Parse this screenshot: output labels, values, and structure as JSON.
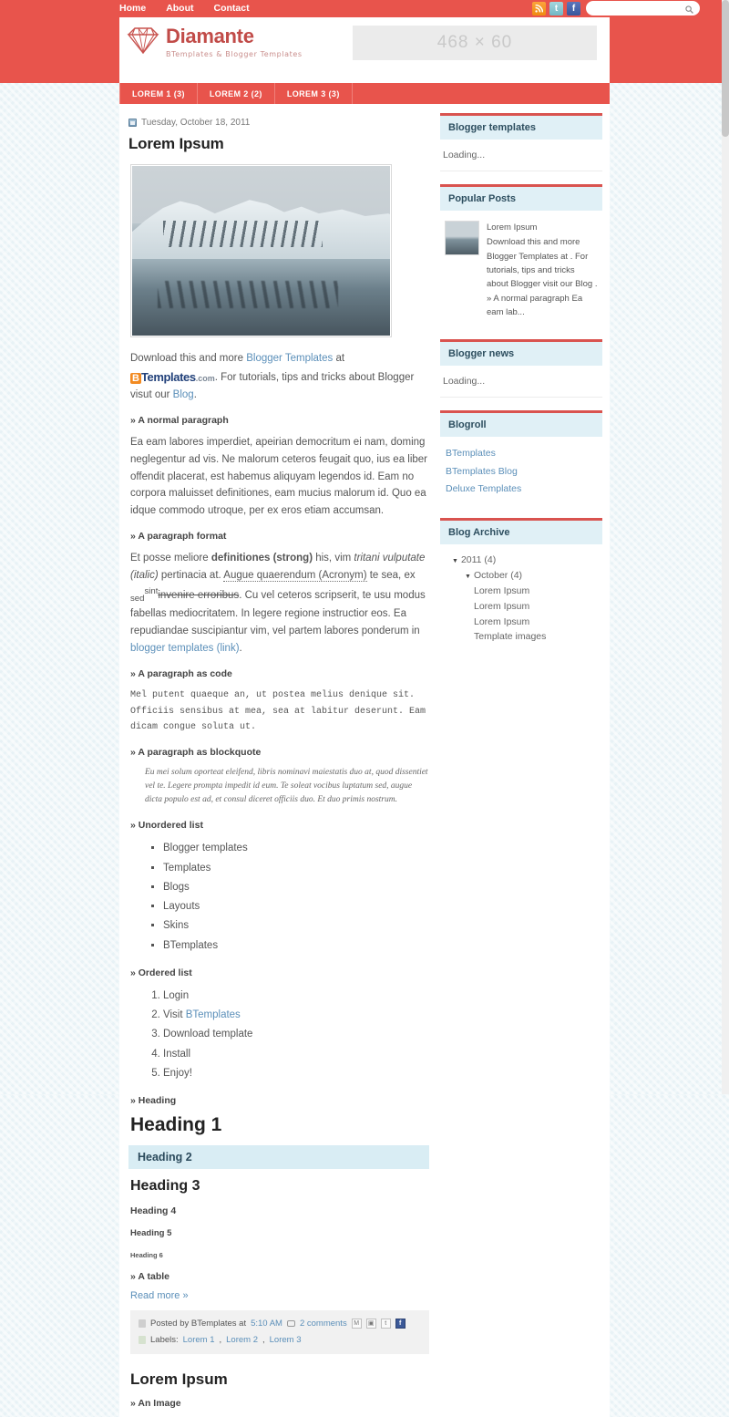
{
  "topbar": {
    "nav": [
      {
        "label": "Home"
      },
      {
        "label": "About"
      },
      {
        "label": "Contact"
      }
    ],
    "social": [
      {
        "name": "rss",
        "glyph": "◕"
      },
      {
        "name": "twitter",
        "glyph": "t"
      },
      {
        "name": "facebook",
        "glyph": "f"
      }
    ],
    "search": {
      "value": "",
      "placeholder": ""
    }
  },
  "header": {
    "brand": "Diamante",
    "tagline": "BTemplates & Blogger Templates",
    "banner_label": "468 × 60"
  },
  "mainnav": [
    {
      "label": "LOREM 1 (3)"
    },
    {
      "label": "LOREM 2 (2)"
    },
    {
      "label": "LOREM 3 (3)"
    }
  ],
  "post": {
    "date": "Tuesday, October 18, 2011",
    "title": "Lorem Ipsum",
    "intro_pre": "Download this and more ",
    "intro_link1": "Blogger Templates",
    "intro_mid": " at ",
    "bt_b": "B",
    "bt_t": "Templates",
    "bt_com": ".com",
    "intro_post": ". For tutorials, tips and tricks about Blogger visut our ",
    "intro_link2": "Blog",
    "intro_end": ".",
    "h_normal": "» A normal paragraph",
    "p_normal": "Ea eam labores imperdiet, apeirian democritum ei nam, doming neglegentur ad vis. Ne malorum ceteros feugait quo, ius ea liber offendit placerat, est habemus aliquyam legendos id. Eam no corpora maluisset definitiones, eam mucius malorum id. Quo ea idque commodo utroque, per ex eros etiam accumsan.",
    "h_format": "» A paragraph format",
    "fmt_1": "Et posse meliore ",
    "fmt_strong": "definitiones (strong)",
    "fmt_2": " his, vim ",
    "fmt_italic": "tritani vulputate (italic)",
    "fmt_3": " pertinacia at. ",
    "fmt_acronym": "Augue quaerendum (Acronym)",
    "fmt_4": " te sea, ex ",
    "fmt_sub": "sed",
    "fmt_sup": "sint",
    "fmt_strike": "invenire erroribus",
    "fmt_5": ". Cu vel ceteros scripserit, te usu modus fabellas mediocritatem. In legere regione instructior eos. Ea repudiandae suscipiantur vim, vel partem labores ponderum in ",
    "fmt_link": "blogger templates (link)",
    "fmt_6": ".",
    "h_code": "» A paragraph as code",
    "code_text": "Mel putent quaeque an, ut postea melius denique sit. Officiis sensibus at mea, sea at labitur deserunt. Eam dicam congue soluta ut.",
    "h_quote": "» A paragraph as blockquote",
    "quote_text": "Eu mei solum oporteat eleifend, libris nominavi maiestatis duo at, quod dissentiet vel te. Legere prompta impedit id eum. Te soleat vocibus luptatum sed, augue dicta populo est ad, et consul diceret officiis duo. Et duo primis nostrum.",
    "h_ul": "» Unordered list",
    "ul_items": [
      "Blogger templates",
      "Templates",
      "Blogs",
      "Layouts",
      "Skins",
      "BTemplates"
    ],
    "h_ol": "» Ordered list",
    "ol_items": [
      "Login",
      "Visit BTemplates",
      "Download template",
      "Install",
      "Enjoy!"
    ],
    "ol_2_pre": "Visit ",
    "ol_2_link": "BTemplates",
    "h_heading": "» Heading",
    "h1": "Heading 1",
    "h2": "Heading 2",
    "h3": "Heading 3",
    "h4": "Heading 4",
    "h5": "Heading 5",
    "h6": "Heading 6",
    "h_table": "» A table",
    "readmore": "Read more »",
    "footer": {
      "posted_by": "Posted by BTemplates at",
      "time": "5:10 AM",
      "comments": "2 comments",
      "labels_label": "Labels:",
      "labels": [
        "Lorem 1",
        "Lorem 2",
        "Lorem 3"
      ],
      "share_icons": [
        {
          "name": "email-share-icon",
          "glyph": "M"
        },
        {
          "name": "blog-share-icon",
          "glyph": "▣"
        },
        {
          "name": "twitter-share-icon",
          "glyph": "t"
        },
        {
          "name": "facebook-share-icon",
          "glyph": "f"
        }
      ]
    }
  },
  "post2": {
    "title": "Lorem Ipsum",
    "h_image": "» An Image"
  },
  "sidebar": {
    "widgets": [
      {
        "title": "Blogger templates",
        "type": "loading",
        "body": "Loading..."
      },
      {
        "title": "Popular Posts",
        "type": "popular",
        "item": {
          "title": "Lorem Ipsum",
          "text": "Download this and more Blogger Templates at . For tutorials, tips and tricks about Blogger visit our Blog . » A normal paragraph Ea eam lab..."
        }
      },
      {
        "title": "Blogger news",
        "type": "loading",
        "body": "Loading..."
      },
      {
        "title": "Blogroll",
        "type": "links",
        "links": [
          "BTemplates",
          "BTemplates Blog",
          "Deluxe Templates"
        ]
      },
      {
        "title": "Blog Archive",
        "type": "archive",
        "archive": [
          {
            "level": 1,
            "label": "2011 (4)",
            "toggle": "▼"
          },
          {
            "level": 2,
            "label": "October (4)",
            "toggle": "▼"
          },
          {
            "level": 3,
            "label": "Lorem Ipsum",
            "toggle": ""
          },
          {
            "level": 3,
            "label": "Lorem Ipsum",
            "toggle": ""
          },
          {
            "level": 3,
            "label": "Lorem Ipsum",
            "toggle": ""
          },
          {
            "level": 3,
            "label": "Template images",
            "toggle": ""
          }
        ]
      }
    ]
  },
  "colors": {
    "brand_red": "#e8544c",
    "widget_blue": "#e0f0f6",
    "link_blue": "#5b8fb9",
    "bg_blue": "#e8f2f6"
  }
}
